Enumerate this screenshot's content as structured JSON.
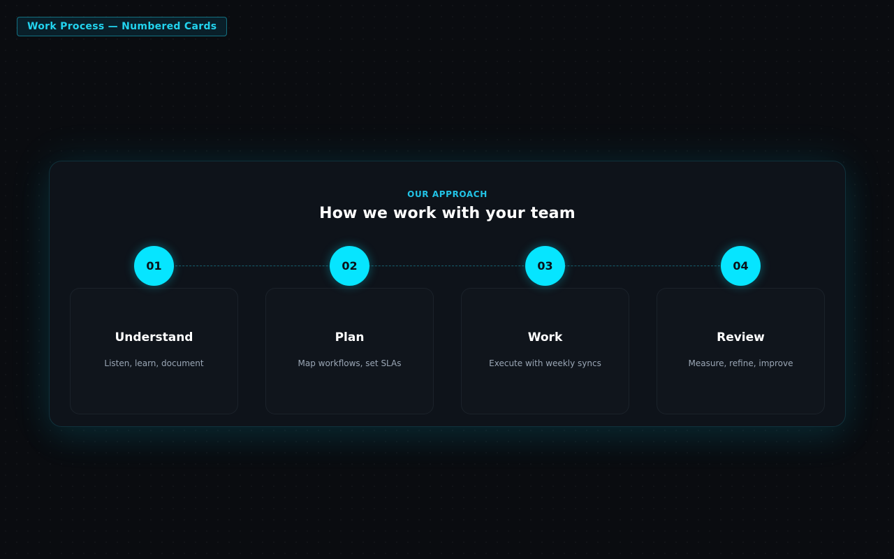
{
  "header": {
    "tag_label": "Work Process — Numbered Cards"
  },
  "section": {
    "eyebrow": "OUR APPROACH",
    "title": "How we work with your team"
  },
  "steps": [
    {
      "number": "01",
      "title": "Understand",
      "description": "Listen, learn, document"
    },
    {
      "number": "02",
      "title": "Plan",
      "description": "Map workflows, set SLAs"
    },
    {
      "number": "03",
      "title": "Work",
      "description": "Execute with weekly syncs"
    },
    {
      "number": "04",
      "title": "Review",
      "description": "Measure, refine, improve"
    }
  ],
  "colors": {
    "accent": "#06e5ff",
    "background": "#0a0c10",
    "panel": "#0e131a",
    "card": "#10151c"
  }
}
